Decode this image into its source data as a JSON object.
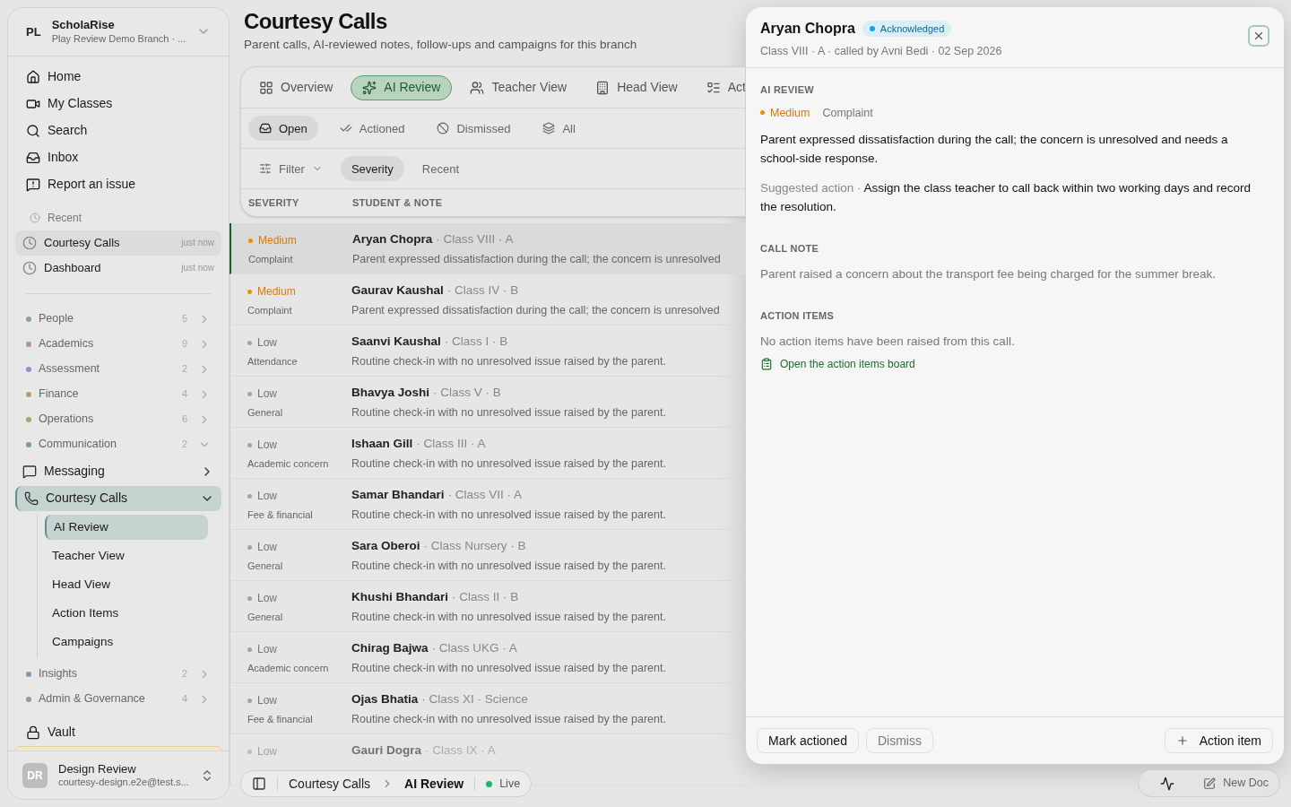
{
  "sidebar": {
    "workspace": {
      "initials": "PL",
      "name": "ScholaRise",
      "branch": "Play Review Demo Branch · ..."
    },
    "nav": [
      {
        "label": "Home"
      },
      {
        "label": "My Classes"
      },
      {
        "label": "Search"
      },
      {
        "label": "Inbox"
      },
      {
        "label": "Report an issue"
      }
    ],
    "recent": {
      "title": "Recent",
      "items": [
        {
          "label": "Courtesy Calls",
          "time": "just now",
          "selected": true
        },
        {
          "label": "Dashboard",
          "time": "just now",
          "selected": false
        }
      ]
    },
    "groups": [
      {
        "kind": "group",
        "label": "People",
        "count": "5",
        "color": "#86a98e",
        "expanded": false
      },
      {
        "kind": "group",
        "label": "Academics",
        "count": "9",
        "color": "#c08a94",
        "expanded": false
      },
      {
        "kind": "group",
        "label": "Assessment",
        "count": "2",
        "color": "#9a8cc0",
        "expanded": false
      },
      {
        "kind": "group",
        "label": "Finance",
        "count": "4",
        "color": "#b79a78",
        "expanded": false
      },
      {
        "kind": "group",
        "label": "Operations",
        "count": "6",
        "color": "#a0a472",
        "expanded": false
      },
      {
        "kind": "group",
        "label": "Communication",
        "count": "2",
        "color": "#6a9fa0",
        "expanded": true
      },
      {
        "kind": "link",
        "label": "Messaging",
        "expanded": false,
        "selected": false
      },
      {
        "kind": "link",
        "label": "Courtesy Calls",
        "expanded": true,
        "selected": true,
        "children": [
          {
            "label": "AI Review",
            "selected": true
          },
          {
            "label": "Teacher View",
            "selected": false
          },
          {
            "label": "Head View",
            "selected": false
          },
          {
            "label": "Action Items",
            "selected": false
          },
          {
            "label": "Campaigns",
            "selected": false
          }
        ]
      },
      {
        "kind": "group",
        "label": "Insights",
        "count": "2",
        "color": "#7c9cc0",
        "expanded": false
      },
      {
        "kind": "group",
        "label": "Admin & Governance",
        "count": "4",
        "color": "#999999",
        "expanded": false
      },
      {
        "kind": "plain",
        "label": "Vault"
      }
    ],
    "user": {
      "initials": "DR",
      "name": "Design Review",
      "email": "courtesy-design.e2e@test.s..."
    }
  },
  "page": {
    "title": "Courtesy Calls",
    "subtitle": "Parent calls, AI-reviewed notes, follow-ups and campaigns for this branch",
    "tabs": [
      {
        "label": "Overview",
        "selected": false
      },
      {
        "label": "AI Review",
        "selected": true
      },
      {
        "label": "Teacher View",
        "selected": false
      },
      {
        "label": "Head View",
        "selected": false
      },
      {
        "label": "Act",
        "selected": false
      }
    ],
    "status_tabs": [
      {
        "label": "Open",
        "selected": true
      },
      {
        "label": "Actioned",
        "selected": false
      },
      {
        "label": "Dismissed",
        "selected": false
      },
      {
        "label": "All",
        "selected": false
      }
    ],
    "filter": "Filter",
    "sort": [
      {
        "label": "Severity",
        "selected": true
      },
      {
        "label": "Recent",
        "selected": false
      }
    ],
    "columns": [
      "SEVERITY",
      "STUDENT & NOTE"
    ],
    "rows": [
      {
        "severity": "Medium",
        "kind": "medium",
        "category": "Complaint",
        "name": "Aryan Chopra",
        "class": "· Class VIII · A",
        "note": "Parent expressed dissatisfaction during the call; the concern is unresolved",
        "selected": true
      },
      {
        "severity": "Medium",
        "kind": "medium",
        "category": "Complaint",
        "name": "Gaurav Kaushal",
        "class": "· Class IV · B",
        "note": "Parent expressed dissatisfaction during the call; the concern is unresolved",
        "selected": false
      },
      {
        "severity": "Low",
        "kind": "low",
        "category": "Attendance",
        "name": "Saanvi Kaushal",
        "class": "· Class I · B",
        "note": "Routine check-in with no unresolved issue raised by the parent.",
        "selected": false
      },
      {
        "severity": "Low",
        "kind": "low",
        "category": "General",
        "name": "Bhavya Joshi",
        "class": "· Class V · B",
        "note": "Routine check-in with no unresolved issue raised by the parent.",
        "selected": false
      },
      {
        "severity": "Low",
        "kind": "low",
        "category": "Academic concern",
        "name": "Ishaan Gill",
        "class": "· Class III · A",
        "note": "Routine check-in with no unresolved issue raised by the parent.",
        "selected": false
      },
      {
        "severity": "Low",
        "kind": "low",
        "category": "Fee & financial",
        "name": "Samar Bhandari",
        "class": "· Class VII · A",
        "note": "Routine check-in with no unresolved issue raised by the parent.",
        "selected": false
      },
      {
        "severity": "Low",
        "kind": "low",
        "category": "General",
        "name": "Sara Oberoi",
        "class": "· Class Nursery · B",
        "note": "Routine check-in with no unresolved issue raised by the parent.",
        "selected": false
      },
      {
        "severity": "Low",
        "kind": "low",
        "category": "General",
        "name": "Khushi Bhandari",
        "class": "· Class II · B",
        "note": "Routine check-in with no unresolved issue raised by the parent.",
        "selected": false
      },
      {
        "severity": "Low",
        "kind": "low",
        "category": "Academic concern",
        "name": "Chirag Bajwa",
        "class": "· Class UKG · A",
        "note": "Routine check-in with no unresolved issue raised by the parent.",
        "selected": false
      },
      {
        "severity": "Low",
        "kind": "low",
        "category": "Fee & financial",
        "name": "Ojas Bhatia",
        "class": "· Class XI · Science",
        "note": "Routine check-in with no unresolved issue raised by the parent.",
        "selected": false
      },
      {
        "severity": "Low",
        "kind": "low",
        "name": "Gauri Dogra",
        "class": "· Class IX · A",
        "selected": false
      }
    ]
  },
  "breadcrumb": {
    "items": [
      "Courtesy Calls",
      "AI Review"
    ],
    "status": "Live"
  },
  "dock": {
    "new_doc": "New Doc"
  },
  "drawer": {
    "name": "Aryan Chopra",
    "status": {
      "label": "Acknowledged",
      "color": "#0ea5e9"
    },
    "meta": "Class VIII · A · called by Avni Bedi · 02 Sep 2026",
    "ai_review": {
      "title": "AI REVIEW",
      "severity": "Medium",
      "kind": "medium",
      "category": "Complaint",
      "summary": "Parent expressed dissatisfaction during the call; the concern is unresolved and needs a school-side response.",
      "suggested_label": "Suggested action ·",
      "suggested": "Assign the class teacher to call back within two working days and record the resolution."
    },
    "call_note": {
      "title": "CALL NOTE",
      "text": "Parent raised a concern about the transport fee being charged for the summer break."
    },
    "action_items": {
      "title": "ACTION ITEMS",
      "empty": "No action items have been raised from this call.",
      "link": "Open the action items board"
    },
    "buttons": [
      {
        "label": "Mark actioned",
        "kind": "primary"
      },
      {
        "label": "Dismiss",
        "kind": "muted"
      },
      {
        "label": "Action item",
        "kind": "add"
      }
    ]
  }
}
